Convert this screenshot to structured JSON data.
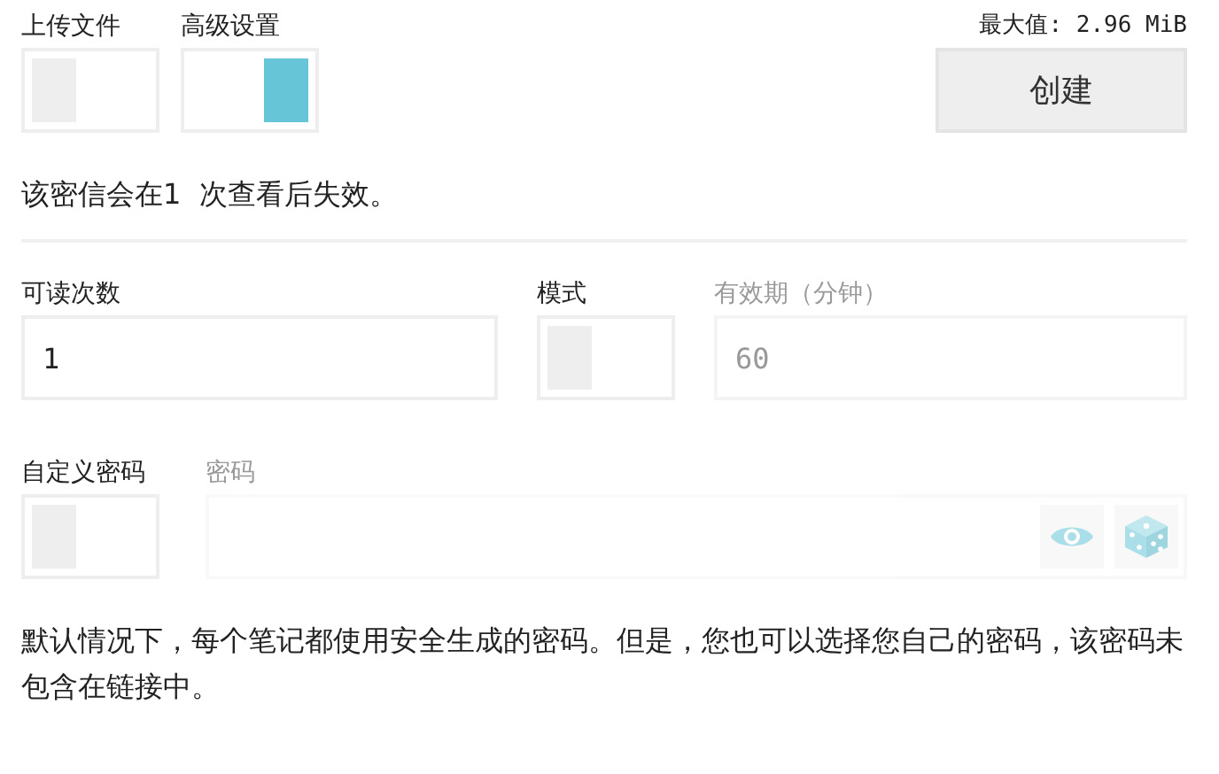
{
  "upload_file": {
    "label": "上传文件",
    "on": false
  },
  "advanced_settings": {
    "label": "高级设置",
    "on": true
  },
  "max_size": "最大值: 2.96 MiB",
  "create_button": "创建",
  "expiry_notice": "该密信会在1  次查看后失效。",
  "read_count": {
    "label": "可读次数",
    "value": "1",
    "disabled": false
  },
  "mode": {
    "label": "模式",
    "on": false
  },
  "expiry_minutes": {
    "label": "有效期（分钟）",
    "value": "60",
    "disabled": true
  },
  "custom_password": {
    "label": "自定义密码",
    "on": false
  },
  "password": {
    "label": "密码",
    "disabled": true
  },
  "help_text": "默认情况下，每个笔记都使用安全生成的密码。但是，您也可以选择您自己的密码，该密码未包含在链接中。"
}
